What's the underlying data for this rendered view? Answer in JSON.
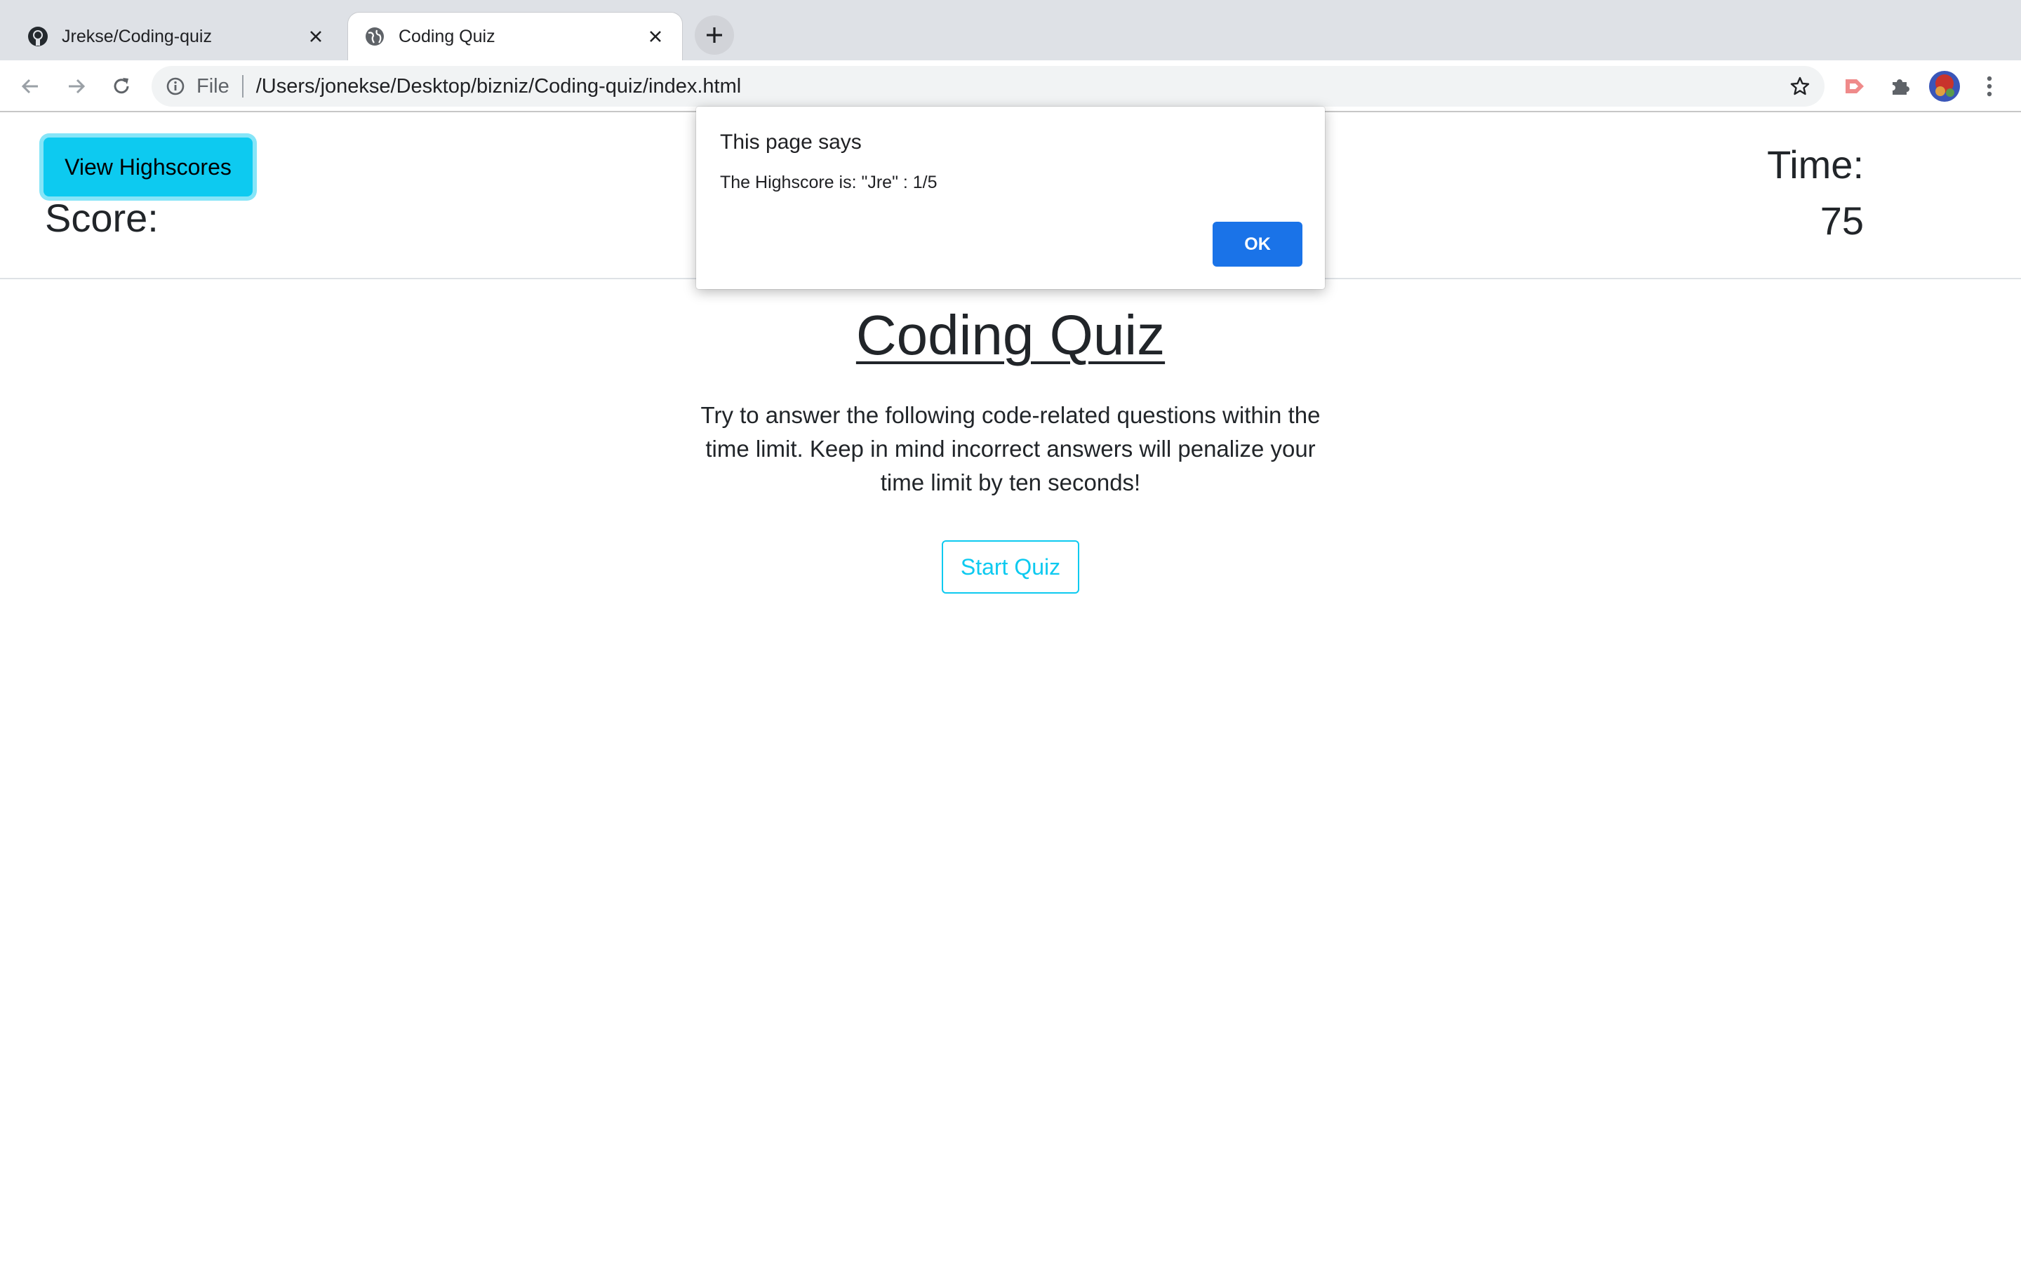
{
  "browser": {
    "tabs": [
      {
        "title": "Jrekse/Coding-quiz",
        "icon": "github-icon",
        "active": false
      },
      {
        "title": "Coding Quiz",
        "icon": "globe-icon",
        "active": true
      }
    ],
    "address": {
      "scheme_label": "File",
      "url": "/Users/jonekse/Desktop/bizniz/Coding-quiz/index.html"
    }
  },
  "page": {
    "highscores_button": "View Highscores",
    "score_label": "Score:",
    "time_label": "Time:",
    "time_value": "75",
    "title": "Coding Quiz",
    "description": "Try to answer the following code-related questions within the time limit. Keep in mind incorrect answers will penalize your time limit by ten seconds!",
    "start_button": "Start Quiz"
  },
  "dialog": {
    "title": "This page says",
    "message": "The Highscore is: \"Jre\" : 1/5",
    "ok_label": "OK"
  },
  "colors": {
    "accent_info": "#0dcaf0",
    "dialog_button": "#1a73e8",
    "chrome_tabbar": "#dee1e6"
  }
}
